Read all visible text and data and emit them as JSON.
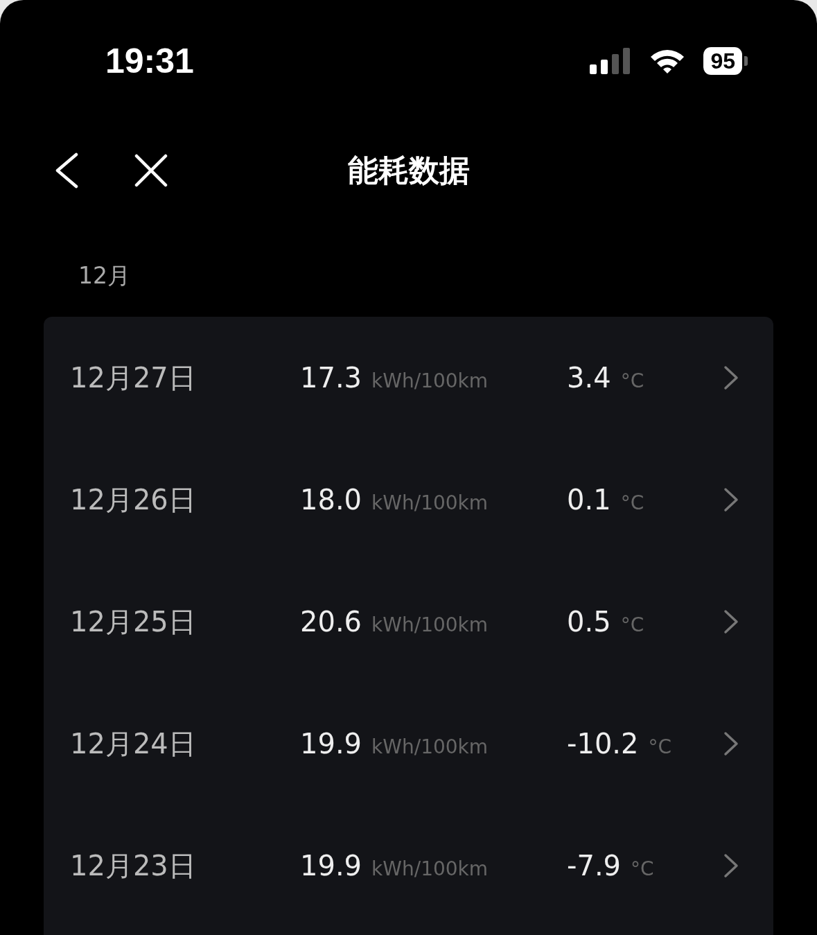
{
  "status_bar": {
    "time": "19:31",
    "battery": "95"
  },
  "nav": {
    "title": "能耗数据"
  },
  "section": {
    "label": "12月"
  },
  "rows": [
    {
      "date": "12月27日",
      "consumption": "17.3",
      "consumption_unit": "kWh/100km",
      "temperature": "3.4",
      "temperature_unit": "°C"
    },
    {
      "date": "12月26日",
      "consumption": "18.0",
      "consumption_unit": "kWh/100km",
      "temperature": "0.1",
      "temperature_unit": "°C"
    },
    {
      "date": "12月25日",
      "consumption": "20.6",
      "consumption_unit": "kWh/100km",
      "temperature": "0.5",
      "temperature_unit": "°C"
    },
    {
      "date": "12月24日",
      "consumption": "19.9",
      "consumption_unit": "kWh/100km",
      "temperature": "-10.2",
      "temperature_unit": "°C"
    },
    {
      "date": "12月23日",
      "consumption": "19.9",
      "consumption_unit": "kWh/100km",
      "temperature": "-7.9",
      "temperature_unit": "°C"
    }
  ]
}
